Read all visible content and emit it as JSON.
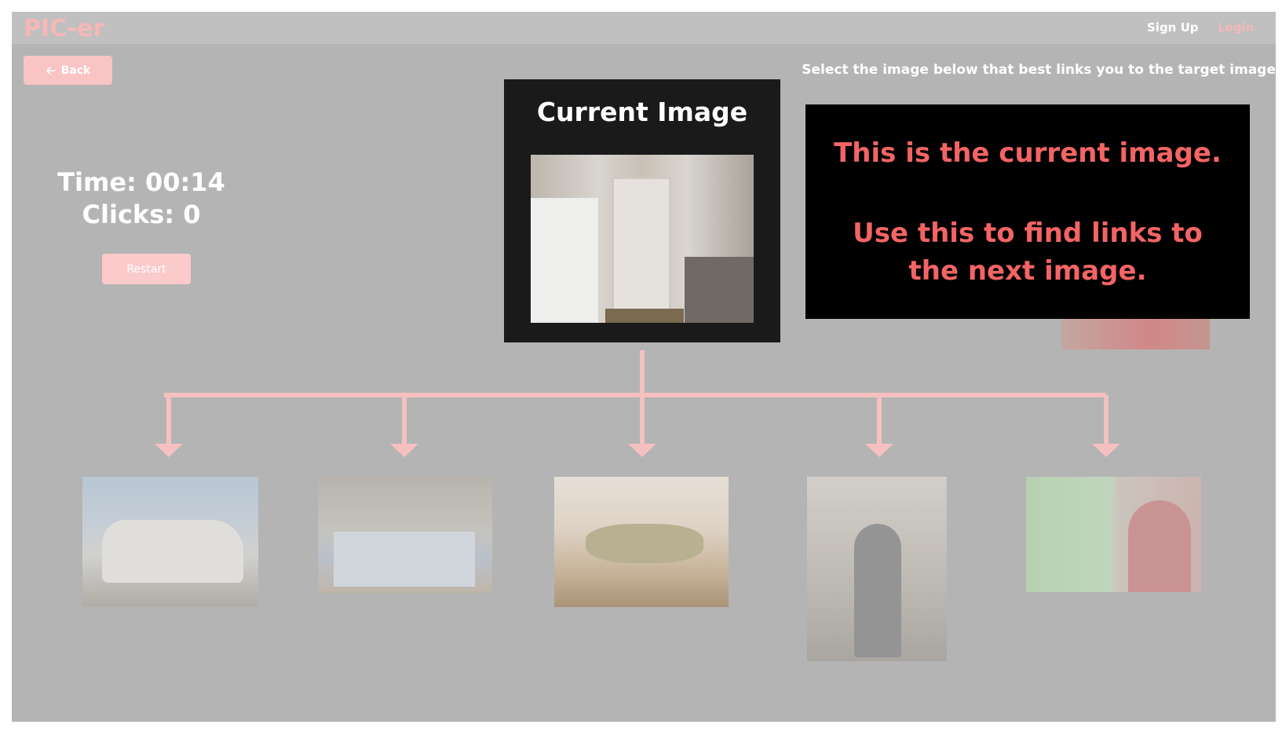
{
  "navbar": {
    "brand": "PIC-er",
    "signup_label": "Sign Up",
    "login_label": "Login"
  },
  "toolbar": {
    "back_label": "Back",
    "instruction": "Select the image below that best links you to the target image"
  },
  "stats": {
    "time_text": "Time: 00:14",
    "clicks_text": "Clicks: 0",
    "restart_label": "Restart"
  },
  "current": {
    "title": "Current Image"
  },
  "tooltip": {
    "line1": "This is the current image.",
    "line2": "Use this to find links to the next image."
  },
  "colors": {
    "accent": "#f7b7b7",
    "tooltip_text": "#f36464",
    "overlay": "#b4b4b4"
  }
}
